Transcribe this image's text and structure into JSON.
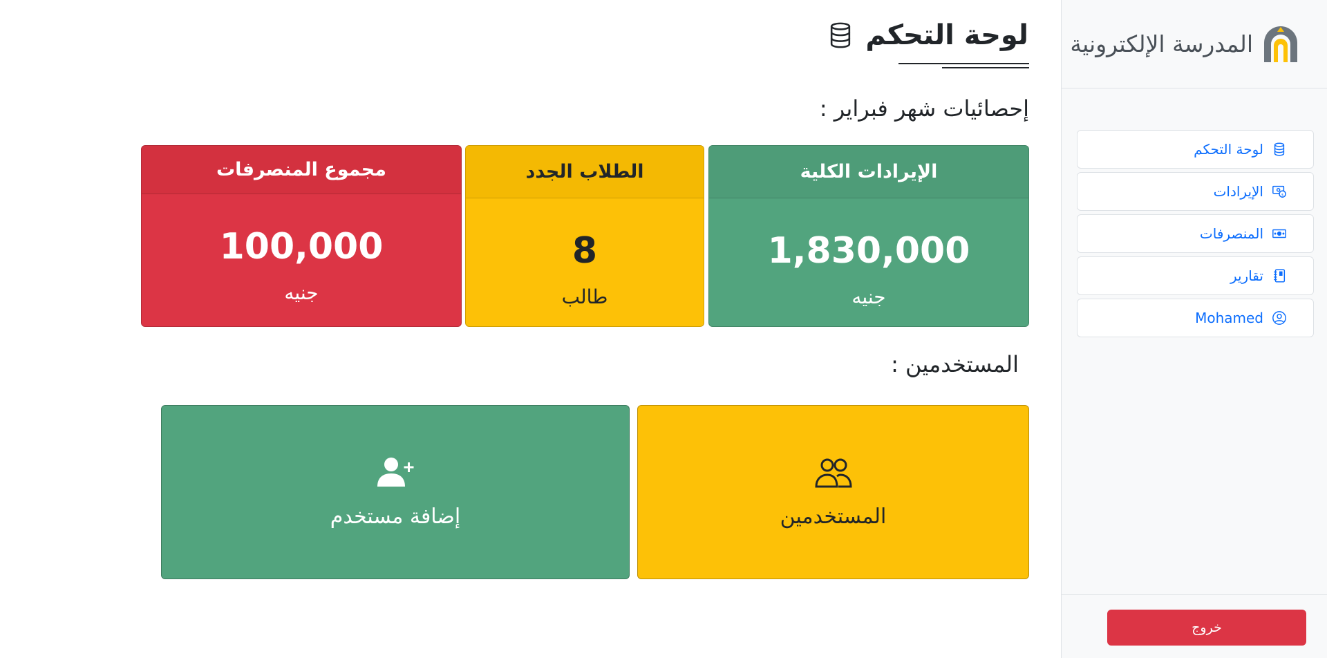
{
  "brand": {
    "name": "المدرسة الإلكترونية",
    "logo_colors": [
      "#6c757d",
      "#fdc107"
    ]
  },
  "sidebar": {
    "items": [
      {
        "label": "لوحة التحكم",
        "icon": "database-icon"
      },
      {
        "label": "الإيرادات",
        "icon": "cash-coin-icon"
      },
      {
        "label": "المنصرفات",
        "icon": "cash-icon"
      },
      {
        "label": "تقارير",
        "icon": "journal-icon"
      },
      {
        "label": "Mohamed",
        "icon": "person-circle-icon"
      }
    ],
    "logout_label": "خروج"
  },
  "main": {
    "title": "لوحة التحكم",
    "stats_title": "إحصائيات شهر فبراير :",
    "stats": [
      {
        "header": "الإيرادات الكلية",
        "value": "1,830,000",
        "unit": "جنيه",
        "color": "#52a47e"
      },
      {
        "header": "الطلاب الجدد",
        "value": "8",
        "unit": "طالب",
        "color": "#fdc107"
      },
      {
        "header": "مجموع المنصرفات",
        "value": "100,000",
        "unit": "جنيه",
        "color": "#dc3545"
      }
    ],
    "users_title": "المستخدمين :",
    "actions": [
      {
        "label": "المستخدمين",
        "icon": "people-icon",
        "color": "#fdc107"
      },
      {
        "label": "إضافة مستخدم",
        "icon": "person-plus-icon",
        "color": "#52a47e"
      }
    ]
  }
}
